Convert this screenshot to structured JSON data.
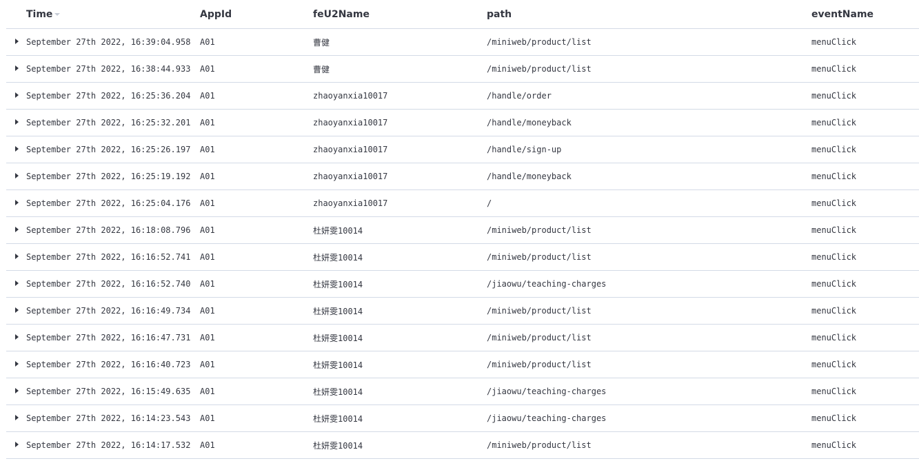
{
  "table": {
    "columns": [
      {
        "key": "time",
        "label": "Time",
        "sorted": "desc"
      },
      {
        "key": "appid",
        "label": "AppId"
      },
      {
        "key": "feU2Name",
        "label": "feU2Name"
      },
      {
        "key": "path",
        "label": "path"
      },
      {
        "key": "eventName",
        "label": "eventName"
      }
    ],
    "rows": [
      {
        "time": "September 27th 2022, 16:39:04.958",
        "appid": "A01",
        "feU2Name": "曹健",
        "path": "/miniweb/product/list",
        "eventName": "menuClick"
      },
      {
        "time": "September 27th 2022, 16:38:44.933",
        "appid": "A01",
        "feU2Name": "曹健",
        "path": "/miniweb/product/list",
        "eventName": "menuClick"
      },
      {
        "time": "September 27th 2022, 16:25:36.204",
        "appid": "A01",
        "feU2Name": "zhaoyanxia10017",
        "path": "/handle/order",
        "eventName": "menuClick"
      },
      {
        "time": "September 27th 2022, 16:25:32.201",
        "appid": "A01",
        "feU2Name": "zhaoyanxia10017",
        "path": "/handle/moneyback",
        "eventName": "menuClick"
      },
      {
        "time": "September 27th 2022, 16:25:26.197",
        "appid": "A01",
        "feU2Name": "zhaoyanxia10017",
        "path": "/handle/sign-up",
        "eventName": "menuClick"
      },
      {
        "time": "September 27th 2022, 16:25:19.192",
        "appid": "A01",
        "feU2Name": "zhaoyanxia10017",
        "path": "/handle/moneyback",
        "eventName": "menuClick"
      },
      {
        "time": "September 27th 2022, 16:25:04.176",
        "appid": "A01",
        "feU2Name": "zhaoyanxia10017",
        "path": "/",
        "eventName": "menuClick"
      },
      {
        "time": "September 27th 2022, 16:18:08.796",
        "appid": "A01",
        "feU2Name": "杜妍雯10014",
        "path": "/miniweb/product/list",
        "eventName": "menuClick"
      },
      {
        "time": "September 27th 2022, 16:16:52.741",
        "appid": "A01",
        "feU2Name": "杜妍雯10014",
        "path": "/miniweb/product/list",
        "eventName": "menuClick"
      },
      {
        "time": "September 27th 2022, 16:16:52.740",
        "appid": "A01",
        "feU2Name": "杜妍雯10014",
        "path": "/jiaowu/teaching-charges",
        "eventName": "menuClick"
      },
      {
        "time": "September 27th 2022, 16:16:49.734",
        "appid": "A01",
        "feU2Name": "杜妍雯10014",
        "path": "/miniweb/product/list",
        "eventName": "menuClick"
      },
      {
        "time": "September 27th 2022, 16:16:47.731",
        "appid": "A01",
        "feU2Name": "杜妍雯10014",
        "path": "/miniweb/product/list",
        "eventName": "menuClick"
      },
      {
        "time": "September 27th 2022, 16:16:40.723",
        "appid": "A01",
        "feU2Name": "杜妍雯10014",
        "path": "/miniweb/product/list",
        "eventName": "menuClick"
      },
      {
        "time": "September 27th 2022, 16:15:49.635",
        "appid": "A01",
        "feU2Name": "杜妍雯10014",
        "path": "/jiaowu/teaching-charges",
        "eventName": "menuClick"
      },
      {
        "time": "September 27th 2022, 16:14:23.543",
        "appid": "A01",
        "feU2Name": "杜妍雯10014",
        "path": "/jiaowu/teaching-charges",
        "eventName": "menuClick"
      },
      {
        "time": "September 27th 2022, 16:14:17.532",
        "appid": "A01",
        "feU2Name": "杜妍雯10014",
        "path": "/miniweb/product/list",
        "eventName": "menuClick"
      }
    ]
  }
}
